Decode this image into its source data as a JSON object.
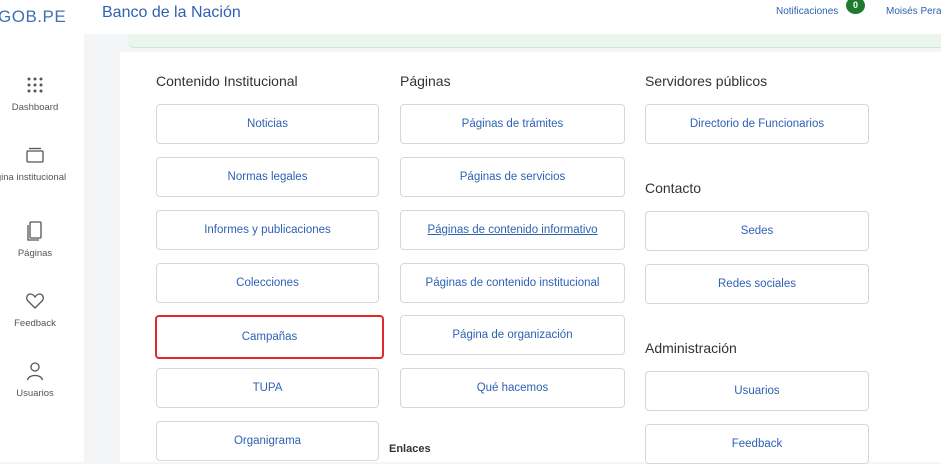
{
  "header": {
    "logo": "GOB.PE",
    "entity": "Banco de la Nación",
    "notifications_label": "Notificaciones",
    "notifications_count": "0",
    "user_name": "Moisés Pera"
  },
  "sidebar": {
    "items": [
      {
        "label": "Dashboard",
        "icon": "grid-icon"
      },
      {
        "label": "gina institucional",
        "icon": "folder-icon"
      },
      {
        "label": "Páginas",
        "icon": "pages-icon"
      },
      {
        "label": "Feedback",
        "icon": "heart-icon"
      },
      {
        "label": "Usuarios",
        "icon": "user-icon"
      }
    ]
  },
  "sections": {
    "contenido": {
      "title": "Contenido Institucional",
      "items": [
        "Noticias",
        "Normas legales",
        "Informes y publicaciones",
        "Colecciones",
        "Campañas",
        "TUPA",
        "Organigrama"
      ],
      "selected": "Campañas"
    },
    "paginas": {
      "title": "Páginas",
      "items": [
        "Páginas de trámites",
        "Páginas de servicios",
        "Páginas de contenido informativo",
        "Páginas de contenido institucional",
        "Página de organización",
        "Qué hacemos"
      ],
      "hovered": "Páginas de contenido informativo"
    },
    "enlaces": {
      "title": "Enlaces"
    },
    "servidores": {
      "title": "Servidores públicos",
      "items": [
        "Directorio de Funcionarios"
      ]
    },
    "contacto": {
      "title": "Contacto",
      "items": [
        "Sedes",
        "Redes sociales"
      ]
    },
    "administracion": {
      "title": "Administración",
      "items": [
        "Usuarios",
        "Feedback"
      ]
    }
  },
  "colors": {
    "accent": "#2e62b3",
    "selected_border": "#e02a2a",
    "badge": "#1f7a2e"
  }
}
